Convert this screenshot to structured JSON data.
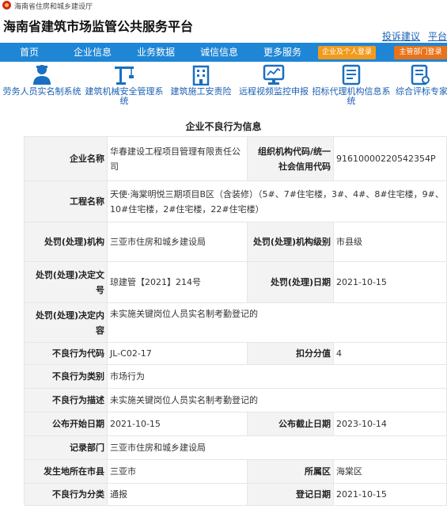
{
  "header": {
    "dept_name": "海南省住房和城乡建设厅",
    "site_title": "海南省建筑市场监管公共服务平台",
    "links": [
      "投诉建议",
      "平台"
    ]
  },
  "nav": {
    "items": [
      "首页",
      "企业信息",
      "业务数据",
      "诚信信息",
      "更多服务"
    ],
    "login_company": "企业及个人登录",
    "login_dept": "主管部门登录"
  },
  "quick_links": [
    {
      "label": "劳务人员实名制系统",
      "icon": "worker-icon"
    },
    {
      "label": "建筑机械安全管理系统",
      "icon": "crane-icon"
    },
    {
      "label": "建筑施工安责险",
      "icon": "building-icon"
    },
    {
      "label": "远程视频监控申报",
      "icon": "monitor-icon"
    },
    {
      "label": "招标代理机构信息系统",
      "icon": "document-icon"
    },
    {
      "label": "综合评标专家系统",
      "icon": "report-icon"
    }
  ],
  "panel_title": "企业不良行为信息",
  "record": {
    "company_label": "企业名称",
    "company": "华春建设工程项目管理有限责任公司",
    "org_code_label": "组织机构代码/统一社会信用代码",
    "org_code": "91610000220542354P",
    "project_label": "工程名称",
    "project": "天使·海棠明悦三期项目B区（含装修）（5#、7#住宅楼，3#、4#、8#住宅楼，9#、10#住宅楼，2#住宅楼，22#住宅楼）",
    "agency_label": "处罚(处理)机构",
    "agency": "三亚市住房和城乡建设局",
    "agency_level_label": "处罚(处理)机构级别",
    "agency_level": "市县级",
    "decision_no_label": "处罚(处理)决定文号",
    "decision_no": "琼建管【2021】214号",
    "decision_date_label": "处罚(处理)日期",
    "decision_date": "2021-10-15",
    "decision_content_label": "处罚(处理)决定内容",
    "decision_content": "未实施关键岗位人员实名制考勤登记的",
    "code_label": "不良行为代码",
    "code": "JL-C02-17",
    "score_label": "扣分分值",
    "score": "4",
    "category_label": "不良行为类别",
    "category": "市场行为",
    "desc_label": "不良行为描述",
    "desc": "未实施关键岗位人员实名制考勤登记的",
    "pub_start_label": "公布开始日期",
    "pub_start": "2021-10-15",
    "pub_end_label": "公布截止日期",
    "pub_end": "2023-10-14",
    "record_dept_label": "记录部门",
    "record_dept": "三亚市住房和城乡建设局",
    "city_label": "发生地所在市县",
    "city": "三亚市",
    "district_label": "所属区",
    "district": "海棠区",
    "type_label": "不良行为分类",
    "type": "通报",
    "reg_date_label": "登记日期",
    "reg_date": "2021-10-15"
  }
}
